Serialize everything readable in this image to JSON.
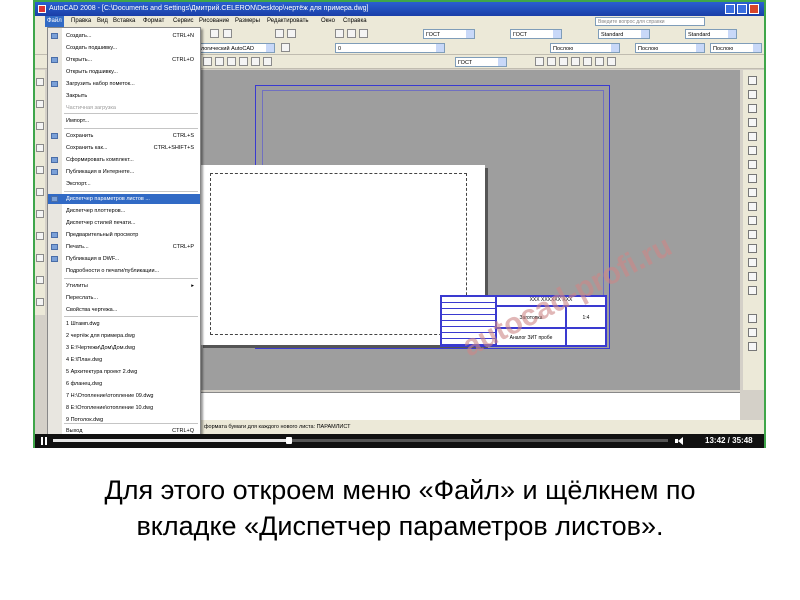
{
  "window": {
    "title": "AutoCAD 2008 - [C:\\Documents and Settings\\Дмитрий.CELERON\\Desktop\\чертёж для примера.dwg]"
  },
  "menubar": {
    "items": [
      "Файл",
      "Правка",
      "Вид",
      "Вставка",
      "Формат",
      "Сервис",
      "Рисование",
      "Размеры",
      "Редактировать",
      "Окно",
      "Справка"
    ],
    "help_placeholder": "Введите вопрос для справки"
  },
  "toolbar": {
    "workspace": "ологический AutoCAD",
    "text_style": "ГОСТ",
    "dim_style": "ГОСТ",
    "table_style": "Standard",
    "mleader_style": "Standard",
    "layer": "0",
    "color": "Послою",
    "linetype": "Послою",
    "lineweight": "Послою",
    "style3": "ГОСТ"
  },
  "file_menu": {
    "items": [
      {
        "label": "Создать...",
        "shortcut": "CTRL+N"
      },
      {
        "label": "Создать подшивку...",
        "shortcut": ""
      },
      {
        "label": "Открыть...",
        "shortcut": "CTRL+O"
      },
      {
        "label": "Открыть подшивку...",
        "shortcut": ""
      },
      {
        "label": "Загрузить набор пометок...",
        "shortcut": ""
      },
      {
        "label": "Закрыть",
        "shortcut": ""
      },
      {
        "label": "Частичная загрузка",
        "shortcut": ""
      },
      {
        "label": "Импорт...",
        "shortcut": ""
      },
      {
        "label": "Сохранить",
        "shortcut": "CTRL+S"
      },
      {
        "label": "Сохранить как...",
        "shortcut": "CTRL+SHIFT+S"
      },
      {
        "label": "Сформировать комплект...",
        "shortcut": ""
      },
      {
        "label": "Публикация в Интернете...",
        "shortcut": ""
      },
      {
        "label": "Экспорт...",
        "shortcut": ""
      },
      {
        "label": "Диспетчер параметров листов ...",
        "shortcut": ""
      },
      {
        "label": "Диспетчер плоттеров...",
        "shortcut": ""
      },
      {
        "label": "Диспетчер стилей печати...",
        "shortcut": ""
      },
      {
        "label": "Предварительный просмотр",
        "shortcut": ""
      },
      {
        "label": "Печать...",
        "shortcut": "CTRL+P"
      },
      {
        "label": "Публикация в DWF...",
        "shortcut": ""
      },
      {
        "label": "Подробности о печати/публикации...",
        "shortcut": ""
      },
      {
        "label": "Утилиты",
        "shortcut": "▸"
      },
      {
        "label": "Переслать...",
        "shortcut": ""
      },
      {
        "label": "Свойства чертежа...",
        "shortcut": ""
      },
      {
        "label": "1 Штамп.dwg",
        "shortcut": ""
      },
      {
        "label": "2 чертёж для примера.dwg",
        "shortcut": ""
      },
      {
        "label": "3 E:\\Чертежи\\Дом\\Дом.dwg",
        "shortcut": ""
      },
      {
        "label": "4 E:\\План.dwg",
        "shortcut": ""
      },
      {
        "label": "5 Архитектура проект 2.dwg",
        "shortcut": ""
      },
      {
        "label": "6 фланец.dwg",
        "shortcut": ""
      },
      {
        "label": "7 H:\\Отопление\\отопление 09.dwg",
        "shortcut": ""
      },
      {
        "label": "8 E:\\Отопление\\отопление 10.dwg",
        "shortcut": ""
      },
      {
        "label": "9 Потолок.dwg",
        "shortcut": ""
      },
      {
        "label": "Выход",
        "shortcut": "CTRL+Q"
      }
    ]
  },
  "drawing": {
    "stamp_code": "XXX XXXXXX XXX",
    "stamp_name": "Заготовка",
    "stamp_scale": "1:4",
    "stamp_org": "Аналог ЗИТ пробе"
  },
  "statusbar": {
    "text": "формата бумаги для каждого нового листа: ПАРАМЛИСТ"
  },
  "watermark": "autocad-profi.ru",
  "player": {
    "time": "13:42 / 35:48",
    "progress": 0.383
  },
  "caption": {
    "line1": "Для этого откроем меню «Файл» и щёлкнем по",
    "line2": "вкладке «Диспетчер параметров листов»."
  }
}
